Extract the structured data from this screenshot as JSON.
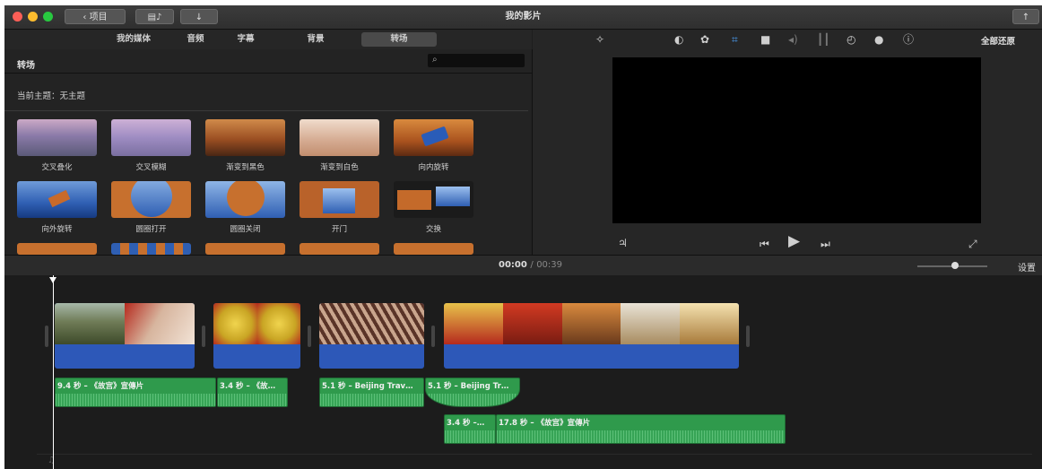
{
  "window": {
    "title": "我的影片"
  },
  "toolbar": {
    "back_label": "项目",
    "share_icon": "share-icon"
  },
  "tabs": [
    {
      "label": "我的媒体"
    },
    {
      "label": "音频"
    },
    {
      "label": "字幕"
    },
    {
      "label": "背景"
    },
    {
      "label": "转场"
    }
  ],
  "browser": {
    "section_title": "转场",
    "search": {
      "placeholder": ""
    },
    "theme_label": "当前主题：无主题",
    "transitions": [
      {
        "label": "交叉叠化"
      },
      {
        "label": "交叉模糊"
      },
      {
        "label": "渐变到黑色"
      },
      {
        "label": "渐变到白色"
      },
      {
        "label": "向内旋转"
      },
      {
        "label": "向外旋转"
      },
      {
        "label": "圆圈打开"
      },
      {
        "label": "圆圈关闭"
      },
      {
        "label": "开门"
      },
      {
        "label": "交换"
      }
    ]
  },
  "viewer": {
    "reset_label": "全部还原"
  },
  "timebar": {
    "current": "00:00",
    "separator": "/",
    "total": "00:39",
    "settings_label": "设置"
  },
  "audio_clips": [
    {
      "label": "9.4 秒 – 《故宫》宣傳片"
    },
    {
      "label": "3.4 秒 – 《故…"
    },
    {
      "label": "5.1 秒 – Beijing Trav…"
    },
    {
      "label": "5.1 秒 – Beijing Tr…"
    },
    {
      "label": "3.4 秒 –…"
    },
    {
      "label": "17.8 秒 – 《故宫》宣傳片"
    }
  ]
}
